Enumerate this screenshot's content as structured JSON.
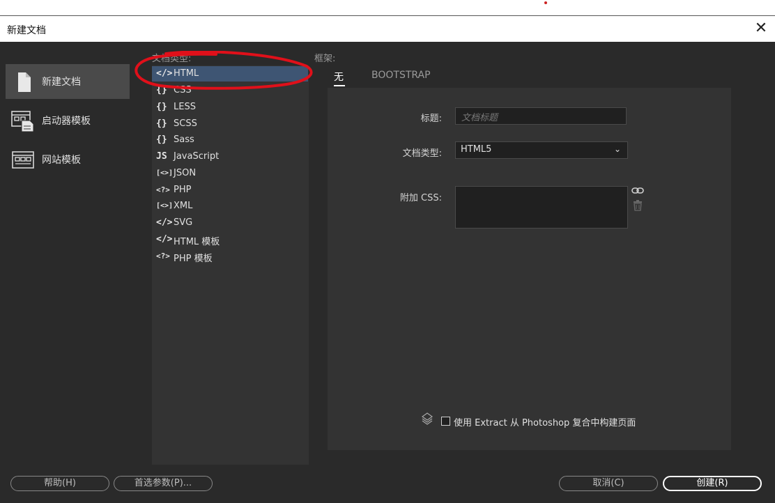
{
  "window": {
    "title": "新建文档"
  },
  "nav": {
    "items": [
      {
        "label": "新建文档",
        "icon": "document-icon",
        "active": true
      },
      {
        "label": "启动器模板",
        "icon": "starter-template-icon",
        "active": false
      },
      {
        "label": "网站模板",
        "icon": "site-template-icon",
        "active": false
      }
    ]
  },
  "doctype": {
    "label": "文档类型:",
    "items": [
      {
        "glyph": "</>",
        "label": "HTML",
        "selected": true
      },
      {
        "glyph": "{}",
        "label": "CSS"
      },
      {
        "glyph": "{}",
        "label": "LESS"
      },
      {
        "glyph": "{}",
        "label": "SCSS"
      },
      {
        "glyph": "{}",
        "label": "Sass"
      },
      {
        "glyph": "JS",
        "label": "JavaScript"
      },
      {
        "glyph": "[<>]",
        "label": "JSON"
      },
      {
        "glyph": "<?>",
        "label": "PHP"
      },
      {
        "glyph": "[<>]",
        "label": "XML"
      },
      {
        "glyph": "</>",
        "label": "SVG"
      },
      {
        "glyph": "</>",
        "label": "HTML 模板"
      },
      {
        "glyph": "<?>",
        "label": "PHP 模板"
      }
    ]
  },
  "framework": {
    "label": "框架:",
    "tabs": [
      {
        "label": "无",
        "active": true
      },
      {
        "label": "BOOTSTRAP",
        "active": false
      }
    ]
  },
  "form": {
    "title_label": "标题:",
    "title_placeholder": "文档标题",
    "doctype_label": "文档类型:",
    "doctype_value": "HTML5",
    "css_label": "附加 CSS:",
    "extract_label": "使用 Extract 从 Photoshop 复合中构建页面",
    "extract_checked": false
  },
  "buttons": {
    "help": "帮助(H)",
    "prefs": "首选参数(P)...",
    "cancel": "取消(C)",
    "create": "创建(R)"
  },
  "colors": {
    "background": "#2a2a2a",
    "panel": "#333333",
    "selection": "#3e5573",
    "annotation": "#e0101a"
  }
}
